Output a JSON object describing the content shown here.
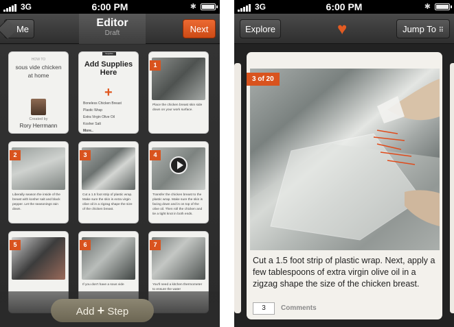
{
  "status": {
    "network": "3G",
    "time": "6:00 PM"
  },
  "editor": {
    "back_label": "Me",
    "title": "Editor",
    "subtitle": "Draft",
    "next_label": "Next",
    "howto": {
      "label": "HOW TO",
      "title": "sous vide chicken at home",
      "created_by": "Created by",
      "creator": "Rory Herrmann"
    },
    "supplies": {
      "tag": "Supplies",
      "title": "Add Supplies Here",
      "items": [
        "Boneless Chicken Breast",
        "Plastic Wrap",
        "Extra Virgin Olive Oil",
        "Kosher Salt"
      ],
      "more": "More.."
    },
    "steps": [
      {
        "num": "1",
        "text": "Place the chicken breast skin side down on your work surface."
      },
      {
        "num": "2",
        "text": "Liberally season the inside of the breast with kosher salt and black pepper. Let the seasonings rain down."
      },
      {
        "num": "3",
        "text": "Cut a 1.5 foot strip of plastic wrap. Make sure the skin is extra virgin olive oil in a zigzag shape the size of the chicken breast."
      },
      {
        "num": "4",
        "text": "Transfer the chicken breast to the plastic wrap. Make sure the skin is facing down and is on top of the olive oil. Then roll the chicken and tie a tight knot in both ends."
      },
      {
        "num": "5",
        "text": ""
      },
      {
        "num": "6",
        "text": "If you don't have a sous vide"
      },
      {
        "num": "7",
        "text": "You'll need a kitchen thermometer to ensure the water"
      }
    ],
    "add_step": {
      "label_left": "Add",
      "plus": "+",
      "label_right": "Step"
    }
  },
  "viewer": {
    "explore_label": "Explore",
    "jump_label": "Jump To",
    "position": "3 of 20",
    "caption": "Cut a 1.5 foot strip of plastic wrap. Next, apply a few tablespoons of extra virgin olive oil in a zigzag shape the size of the chicken breast.",
    "comments_count": "3",
    "comments_label": "Comments"
  },
  "colors": {
    "accent": "#d9531e",
    "heart": "#e25b22",
    "add_step_bg": "#7c7662"
  }
}
